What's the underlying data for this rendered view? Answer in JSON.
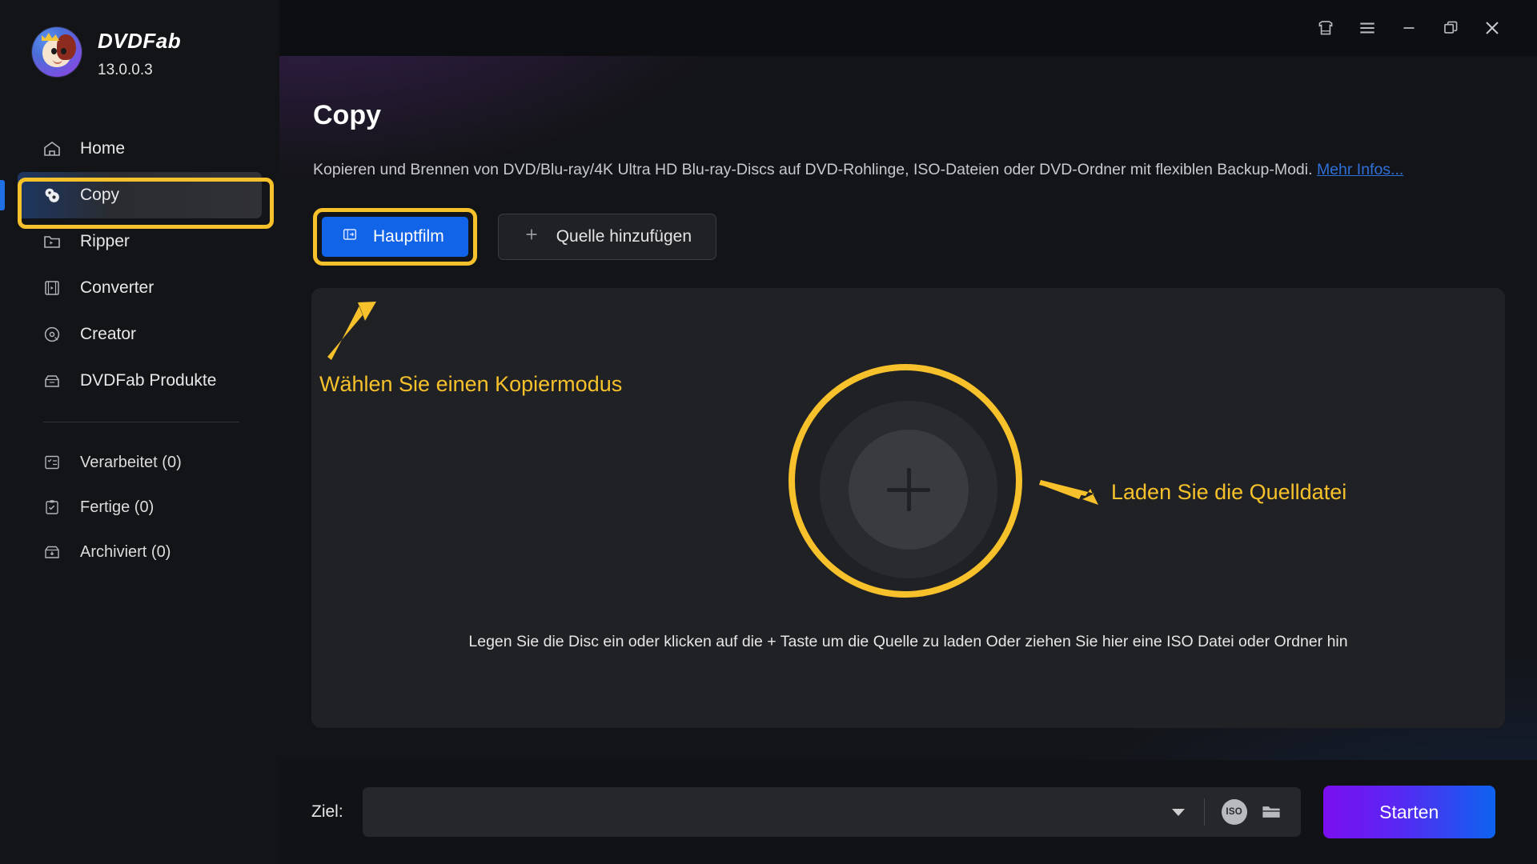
{
  "app": {
    "brand_name_bold": "DVD",
    "brand_name_light": "Fab",
    "version": "13.0.0.3"
  },
  "titlebar": {
    "buttons": [
      {
        "name": "theme-shirt-icon",
        "label": ""
      },
      {
        "name": "menu-icon",
        "label": ""
      },
      {
        "name": "minimize-icon",
        "label": ""
      },
      {
        "name": "maximize-icon",
        "label": ""
      },
      {
        "name": "close-icon",
        "label": ""
      }
    ]
  },
  "sidebar": {
    "items": [
      {
        "label": "Home",
        "icon": "home-icon",
        "active": false
      },
      {
        "label": "Copy",
        "icon": "disc-copy-icon",
        "active": true
      },
      {
        "label": "Ripper",
        "icon": "ripper-folder-icon",
        "active": false
      },
      {
        "label": "Converter",
        "icon": "film-icon",
        "active": false
      },
      {
        "label": "Creator",
        "icon": "disc-icon",
        "active": false
      },
      {
        "label": "DVDFab Produkte",
        "icon": "box-icon",
        "active": false
      }
    ],
    "secondary_items": [
      {
        "label": "Verarbeitet (0)",
        "icon": "tasklist-icon"
      },
      {
        "label": "Fertige (0)",
        "icon": "clipboard-check-icon"
      },
      {
        "label": "Archiviert (0)",
        "icon": "archive-icon"
      }
    ]
  },
  "main": {
    "title": "Copy",
    "description_part1": "Kopieren und Brennen von DVD/Blu-ray/4K Ultra HD Blu-ray-Discs auf DVD-Rohlinge, ISO-Dateien oder DVD-Ordner mit flexiblen Backup-Modi. ",
    "description_link": "Mehr Infos...",
    "buttons": {
      "main_movie": "Hauptfilm",
      "add_source": "Quelle hinzufügen"
    },
    "dropzone_hint": "Legen Sie die Disc ein oder klicken auf die + Taste um die Quelle zu laden Oder ziehen Sie hier eine ISO Datei oder Ordner hin"
  },
  "annotations": {
    "select_copy_mode": "Wählen Sie einen Kopiermodus",
    "load_source_file": "Laden Sie die Quelldatei",
    "highlight_color": "#f7c12b"
  },
  "bottombar": {
    "target_label": "Ziel:",
    "target_value": "",
    "target_placeholder": "",
    "iso_badge": "ISO",
    "start_button": "Starten"
  },
  "colors": {
    "accent_blue": "#1163e8",
    "highlight_yellow": "#f7c12b",
    "start_gradient_from": "#7b0ff0",
    "start_gradient_to": "#0d63f0",
    "link_blue": "#2f6fd8"
  }
}
